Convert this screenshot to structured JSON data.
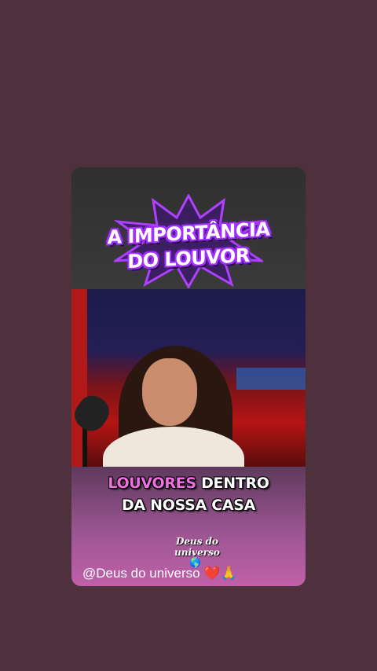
{
  "title": {
    "line1": "A IMPORTÂNCIA",
    "line2": "DO LOUVOR"
  },
  "subtitle": {
    "highlight": "LOUVORES",
    "line1_rest": " DENTRO",
    "line2": "DA NOSSA CASA"
  },
  "watermark": {
    "line1": "Deus do",
    "line2": "universo",
    "globe": "🌎"
  },
  "caption": {
    "text": "@Deus do universo ❤️🙏"
  },
  "colors": {
    "background": "#4f313d",
    "title_glow": "#a230ff",
    "highlight": "#f070e4"
  }
}
